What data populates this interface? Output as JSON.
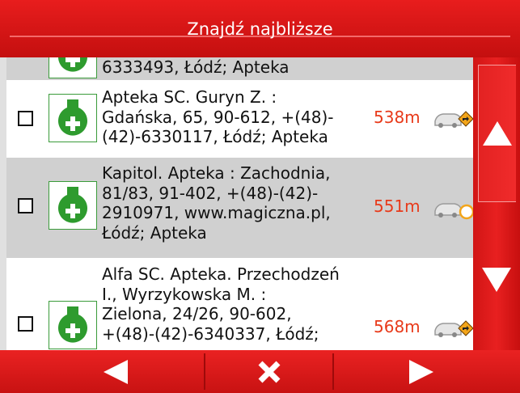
{
  "header": {
    "title": "Znajdź najbliższe"
  },
  "items": [
    {
      "text": "6333493, Łódź; Apteka",
      "distance": ""
    },
    {
      "text": "Apteka SC. Guryn Z. :\nGdańska, 65, 90-612, +(48)-\n(42)-6330117, Łódź; Apteka",
      "distance": "538m"
    },
    {
      "text": "Kapitol. Apteka : Zachodnia,\n81/83, 91-402, +(48)-(42)-\n2910971, www.magiczna.pl,\nŁódź; Apteka",
      "distance": "551m"
    },
    {
      "text": "Alfa SC. Apteka. Przechodzeń\nI., Wyrzykowska M. :\nZielona, 24/26, 90-602,\n+(48)-(42)-6340337, Łódź;",
      "distance": "568m"
    }
  ],
  "icons": {
    "pharmacy": "pharmacy-icon",
    "navigate": "car-navigate-icon",
    "scroll_up": "arrow-up-icon",
    "scroll_down": "arrow-down-icon",
    "prev": "arrow-left-icon",
    "close": "close-icon",
    "next": "arrow-right-icon"
  },
  "colors": {
    "accent": "#e01818",
    "distance": "#e83a1a",
    "pharmacy_green": "#2e9b2e"
  }
}
